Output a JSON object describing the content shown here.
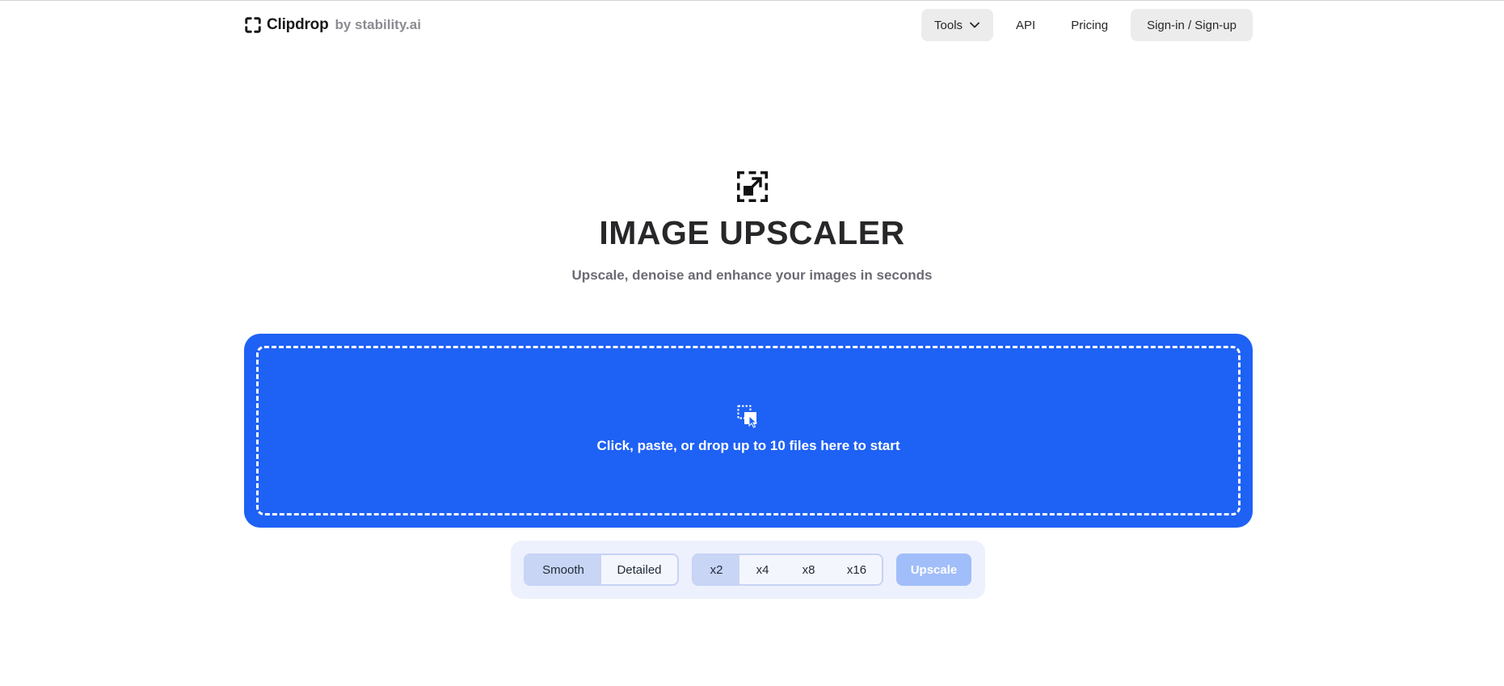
{
  "brand": {
    "name": "Clipdrop",
    "by": "by stability.ai",
    "logo_icon": "clipdrop-bracket-icon"
  },
  "nav": {
    "tools_label": "Tools",
    "tools_icon": "chevron-down-icon",
    "api_label": "API",
    "pricing_label": "Pricing",
    "signin_label": "Sign-in / Sign-up"
  },
  "hero": {
    "icon": "upscale-frame-icon",
    "title": "IMAGE UPSCALER",
    "subtitle": "Upscale, denoise and enhance your images in seconds"
  },
  "dropzone": {
    "icon": "drop-file-icon",
    "text": "Click, paste, or drop up to 10 files here to start"
  },
  "controls": {
    "modes": [
      {
        "label": "Smooth",
        "selected": true
      },
      {
        "label": "Detailed",
        "selected": false
      }
    ],
    "scales": [
      {
        "label": "x2",
        "selected": true
      },
      {
        "label": "x4",
        "selected": false
      },
      {
        "label": "x8",
        "selected": false
      },
      {
        "label": "x16",
        "selected": false
      }
    ],
    "upscale_label": "Upscale"
  },
  "colors": {
    "accent": "#1e61f5",
    "upscale_disabled": "#a1bdfa",
    "control_panel": "#edf1fd",
    "segment_selected": "#c9d5f5"
  }
}
